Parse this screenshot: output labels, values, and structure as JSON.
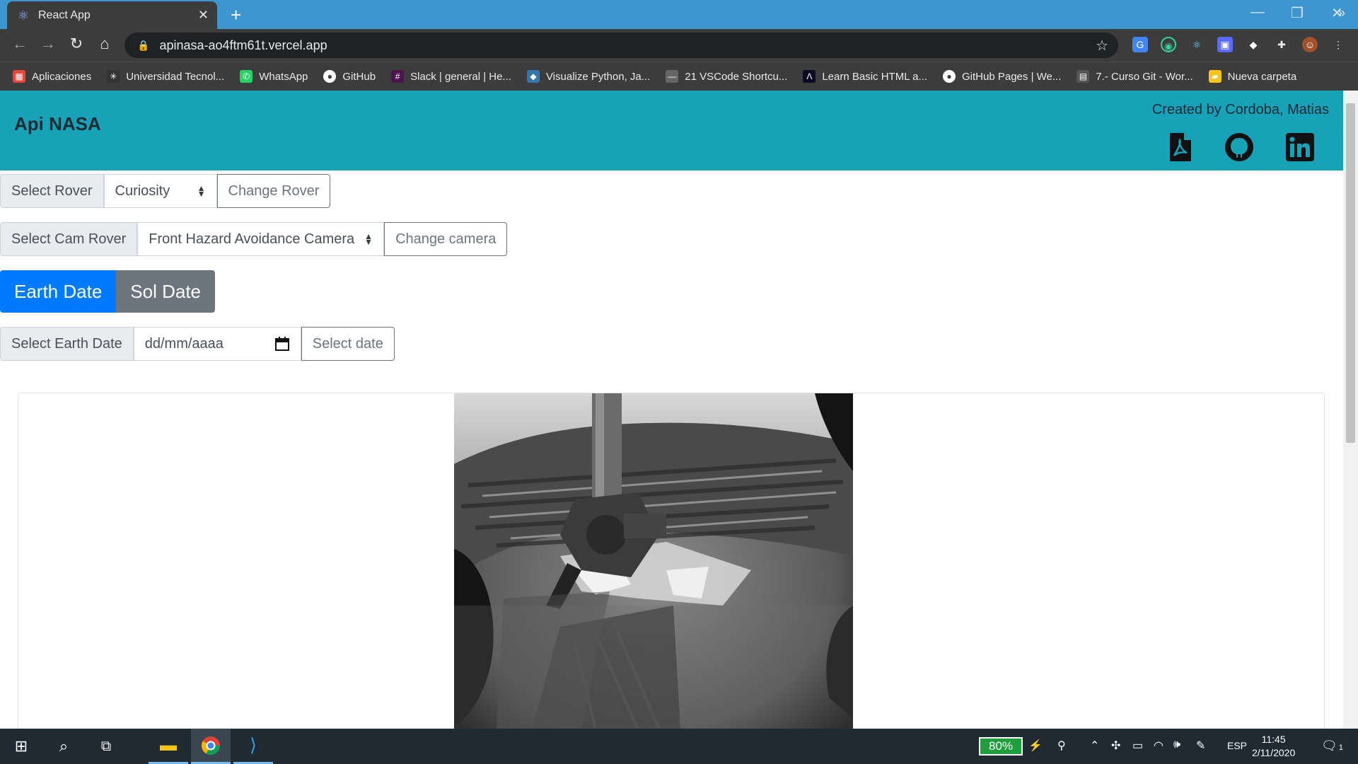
{
  "browser": {
    "tab_title": "React App",
    "url": "apinasa-ao4ftm61t.vercel.app",
    "bookmarks": [
      {
        "label": "Aplicaciones",
        "icon": "apps-grid-icon",
        "color": "#e8453c"
      },
      {
        "label": "Universidad Tecnol...",
        "icon": "utn-logo-icon",
        "color": "#333333"
      },
      {
        "label": "WhatsApp",
        "icon": "whatsapp-icon",
        "color": "#25d366"
      },
      {
        "label": "GitHub",
        "icon": "github-icon",
        "color": "#ffffff"
      },
      {
        "label": "Slack | general | He...",
        "icon": "slack-icon",
        "color": "#4a154b"
      },
      {
        "label": "Visualize Python, Ja...",
        "icon": "python-icon",
        "color": "#3776ab"
      },
      {
        "label": "21 VSCode Shortcu...",
        "icon": "link-icon",
        "color": "#666666"
      },
      {
        "label": "Learn Basic HTML a...",
        "icon": "freecodecamp-icon",
        "color": "#0a0a23"
      },
      {
        "label": "GitHub Pages | We...",
        "icon": "github-icon",
        "color": "#ffffff"
      },
      {
        "label": "7.- Curso Git - Wor...",
        "icon": "page-icon",
        "color": "#555555"
      },
      {
        "label": "Nueva carpeta",
        "icon": "folder-icon",
        "color": "#f5c518"
      }
    ]
  },
  "header": {
    "title": "Api NASA",
    "credits": "Created by Cordoba, Matias",
    "links": [
      {
        "name": "pdf-resume-icon"
      },
      {
        "name": "github-icon"
      },
      {
        "name": "linkedin-icon"
      }
    ]
  },
  "rover": {
    "label": "Select Rover",
    "selected": "Curiosity",
    "button": "Change Rover"
  },
  "camera": {
    "label": "Select Cam Rover",
    "selected": "Front Hazard Avoidance Camera",
    "button": "Change camera"
  },
  "date_mode": {
    "earth": "Earth Date",
    "sol": "Sol Date",
    "active": "earth"
  },
  "earth_date": {
    "label": "Select Earth Date",
    "placeholder": "dd/mm/aaaa",
    "button": "Select date"
  },
  "colors": {
    "header_bg": "#17a2b8",
    "primary": "#007bff",
    "secondary": "#6c757d"
  },
  "taskbar": {
    "battery": "80%",
    "language": "ESP",
    "time": "11:45",
    "date": "2/11/2020",
    "notifications": "1"
  }
}
